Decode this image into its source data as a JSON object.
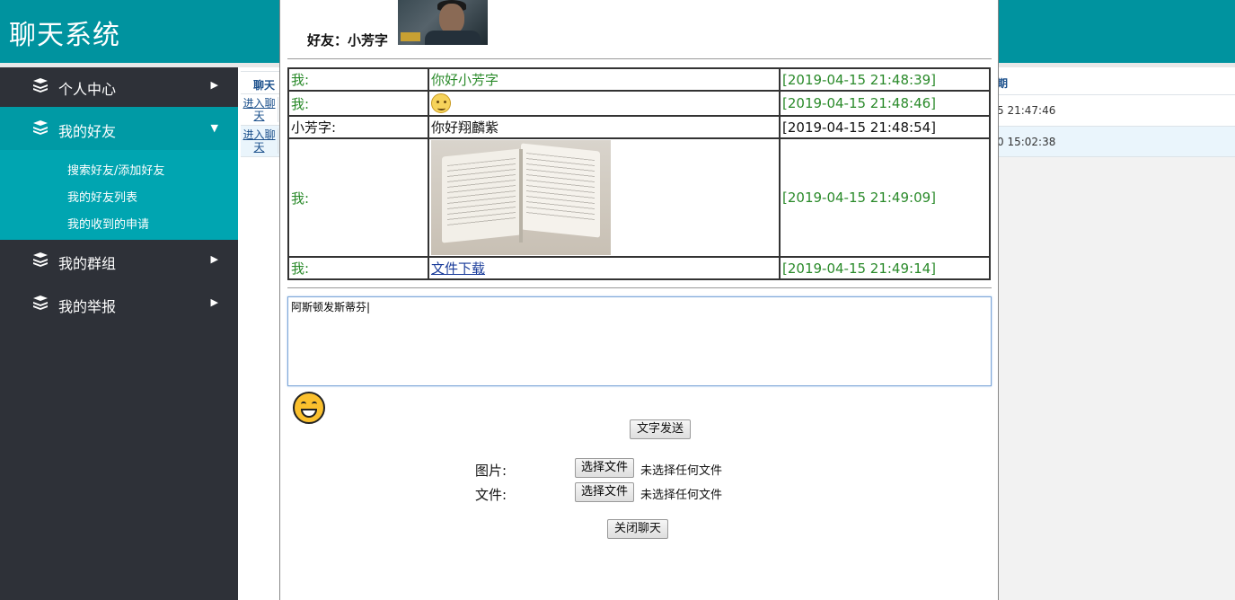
{
  "header": {
    "title": "聊天系统"
  },
  "sidebar": {
    "items": [
      {
        "label": "个人中心",
        "icon": "stack-icon",
        "arrow": "▶"
      },
      {
        "label": "我的好友",
        "icon": "stack-icon",
        "arrow": "▼",
        "active": true,
        "sub": [
          "搜索好友/添加好友",
          "我的好友列表",
          "我的收到的申请"
        ]
      },
      {
        "label": "我的群组",
        "icon": "stack-icon",
        "arrow": "▶"
      },
      {
        "label": "我的举报",
        "icon": "stack-icon",
        "arrow": "▶"
      }
    ]
  },
  "background_table": {
    "header_left": "聊天",
    "header_right": "期",
    "rows": [
      {
        "link": "进入聊天",
        "date": "5 21:47:46"
      },
      {
        "link": "进入聊天",
        "date": "0 15:02:38"
      }
    ]
  },
  "chat": {
    "friend_label": "好友：小芳字",
    "messages": [
      {
        "sender": "我:",
        "content": "你好小芳字",
        "time": "[2019-04-15 21:48:39]"
      },
      {
        "sender": "我:",
        "content": "",
        "time": "[2019-04-15 21:48:46]"
      },
      {
        "sender": "小芳字:",
        "content": "你好翔麟紫",
        "time": "[2019-04-15 21:48:54]"
      },
      {
        "sender": "我:",
        "content": "",
        "time": "[2019-04-15 21:49:09]"
      },
      {
        "sender": "我:",
        "content": "文件下载",
        "time": "[2019-04-15 21:49:14]"
      }
    ],
    "input_value": "阿斯顿发斯蒂芬|",
    "send_label": "文字发送",
    "image_label": "图片:",
    "file_label": "文件:",
    "choose_file_label": "选择文件",
    "no_file_label": "未选择任何文件",
    "close_label": "关闭聊天"
  },
  "colors": {
    "header": "#00939f",
    "sidebar": "#2e3138",
    "active": "#009aa5",
    "green_text": "#2a8a2a"
  }
}
